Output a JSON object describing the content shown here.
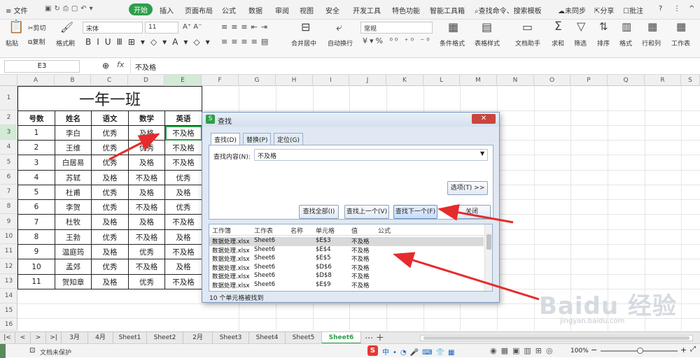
{
  "menu": {
    "items": [
      "文件",
      "开始",
      "插入",
      "页面布局",
      "公式",
      "数据",
      "审阅",
      "视图",
      "安全",
      "开发工具",
      "特色功能",
      "智能工具箱"
    ],
    "search": "查找命令、搜索模板",
    "sync": "未同步",
    "share": "分享",
    "comment": "批注"
  },
  "ribbon": {
    "paste": "粘贴",
    "cut": "剪切",
    "copy": "复制",
    "painter": "格式刷",
    "font": "宋体",
    "size": "11",
    "merge": "合并居中",
    "wrap": "自动换行",
    "numfmt": "常规",
    "cond": "条件格式",
    "tablefmt": "表格样式",
    "doc": "文档助手",
    "sum": "求和",
    "filter": "筛选",
    "sort": "排序",
    "format": "格式",
    "rowcol": "行和列",
    "sheet": "工作表"
  },
  "formula": {
    "cell": "E3",
    "fx": "fx",
    "value": "不及格"
  },
  "columns": [
    "A",
    "B",
    "C",
    "D",
    "E",
    "F",
    "G",
    "H",
    "I",
    "J",
    "K",
    "L",
    "M",
    "N",
    "O",
    "P",
    "Q",
    "R",
    "S"
  ],
  "rows": [
    "1",
    "2",
    "3",
    "4",
    "5",
    "6",
    "7",
    "8",
    "9",
    "10",
    "11",
    "12",
    "13",
    "14",
    "15",
    "16"
  ],
  "sheet": {
    "title": "一年一班",
    "headers": [
      "号数",
      "姓名",
      "语文",
      "数学",
      "英语"
    ],
    "data": [
      [
        "1",
        "李白",
        "优秀",
        "及格",
        "不及格"
      ],
      [
        "2",
        "王维",
        "优秀",
        "优秀",
        "不及格"
      ],
      [
        "3",
        "白居易",
        "优秀",
        "及格",
        "不及格"
      ],
      [
        "4",
        "苏轼",
        "及格",
        "不及格",
        "优秀"
      ],
      [
        "5",
        "杜甫",
        "优秀",
        "及格",
        "及格"
      ],
      [
        "6",
        "李贺",
        "优秀",
        "不及格",
        "优秀"
      ],
      [
        "7",
        "杜牧",
        "及格",
        "及格",
        "不及格"
      ],
      [
        "8",
        "王勃",
        "优秀",
        "不及格",
        "及格"
      ],
      [
        "9",
        "温庭筠",
        "及格",
        "优秀",
        "不及格"
      ],
      [
        "10",
        "孟郊",
        "优秀",
        "不及格",
        "及格"
      ],
      [
        "11",
        "贺知章",
        "及格",
        "优秀",
        "不及格"
      ]
    ]
  },
  "dialog": {
    "title": "查找",
    "tabs": [
      "查找(D)",
      "替换(P)",
      "定位(G)"
    ],
    "find_label": "查找内容(N):",
    "find_value": "不及格",
    "options": "选项(T) >>",
    "find_all": "查找全部(I)",
    "find_prev": "查找上一个(V)",
    "find_next": "查找下一个(F)",
    "close": "关闭",
    "result_headers": [
      "工作簿",
      "工作表",
      "名称",
      "单元格",
      "值",
      "公式"
    ],
    "results": [
      [
        "数据处理.xlsx",
        "Sheet6",
        "",
        "$E$3",
        "不及格"
      ],
      [
        "数据处理.xlsx",
        "Sheet6",
        "",
        "$E$4",
        "不及格"
      ],
      [
        "数据处理.xlsx",
        "Sheet6",
        "",
        "$E$5",
        "不及格"
      ],
      [
        "数据处理.xlsx",
        "Sheet6",
        "",
        "$D$6",
        "不及格"
      ],
      [
        "数据处理.xlsx",
        "Sheet6",
        "",
        "$D$8",
        "不及格"
      ],
      [
        "数据处理.xlsx",
        "Sheet6",
        "",
        "$E$9",
        "不及格"
      ]
    ],
    "status": "10 个单元格被找到"
  },
  "tabs": [
    "3月",
    "4月",
    "Sheet1",
    "Sheet2",
    "2月",
    "Sheet3",
    "Sheet4",
    "Sheet5",
    "Sheet6"
  ],
  "statusbar": {
    "protect": "文档未保护",
    "zoom": "100%"
  },
  "watermark": {
    "logo": "Baidu 经验",
    "url": "jingyan.baidu.com"
  }
}
